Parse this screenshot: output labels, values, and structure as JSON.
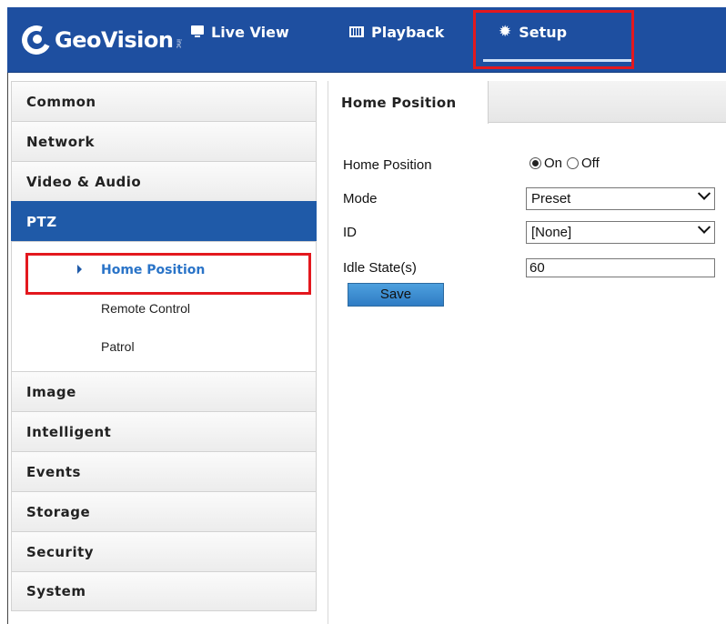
{
  "header": {
    "logo_text": "GeoVision",
    "logo_suffix": "inc",
    "tabs": [
      {
        "label": "Live View",
        "icon": "monitor-icon"
      },
      {
        "label": "Playback",
        "icon": "film-icon"
      },
      {
        "label": "Setup",
        "icon": "gear-icon",
        "active": true
      }
    ],
    "accent_color": "#1e4fa0"
  },
  "sidebar": {
    "items": [
      {
        "label": "Common"
      },
      {
        "label": "Network"
      },
      {
        "label": "Video & Audio"
      },
      {
        "label": "PTZ",
        "active": true
      },
      {
        "label": "Image"
      },
      {
        "label": "Intelligent"
      },
      {
        "label": "Events"
      },
      {
        "label": "Storage"
      },
      {
        "label": "Security"
      },
      {
        "label": "System"
      }
    ],
    "ptz_subitems": [
      {
        "label": "Home Position",
        "selected": true
      },
      {
        "label": "Remote Control"
      },
      {
        "label": "Patrol"
      }
    ]
  },
  "main": {
    "tab_label": "Home Position",
    "fields": {
      "home_position_label": "Home Position",
      "on_label": "On",
      "off_label": "Off",
      "home_position_value": "On",
      "mode_label": "Mode",
      "mode_value": "Preset",
      "id_label": "ID",
      "id_value": "[None]",
      "idle_label": "Idle State(s)",
      "idle_value": "60"
    },
    "save_label": "Save"
  },
  "highlight_color": "#e3181e"
}
